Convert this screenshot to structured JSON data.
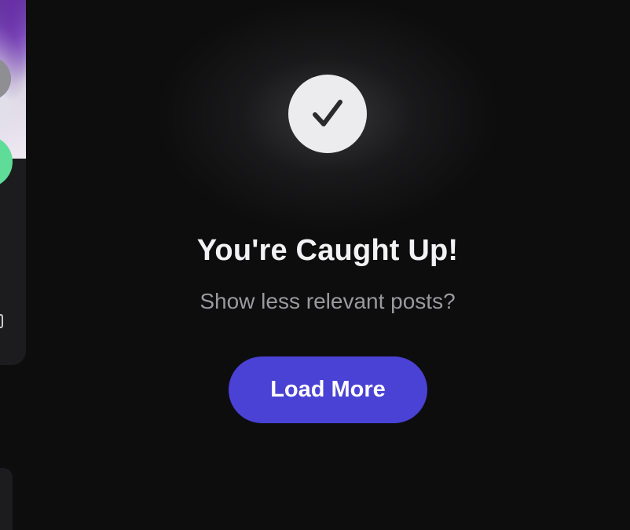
{
  "feed_end": {
    "title": "You're Caught Up!",
    "subtitle": "Show less relevant posts?",
    "load_more_label": "Load More",
    "check_icon": "checkmark-icon"
  },
  "colors": {
    "background": "#0d0d0e",
    "button": "#4a42d4",
    "check_circle": "#ececee",
    "card": "#1c1c1e",
    "green_accent": "#5fdc97"
  },
  "left_card": {
    "image_icon": "post-image",
    "avatar_icon": "avatar-icon",
    "badge_icon": "green-badge-icon"
  }
}
